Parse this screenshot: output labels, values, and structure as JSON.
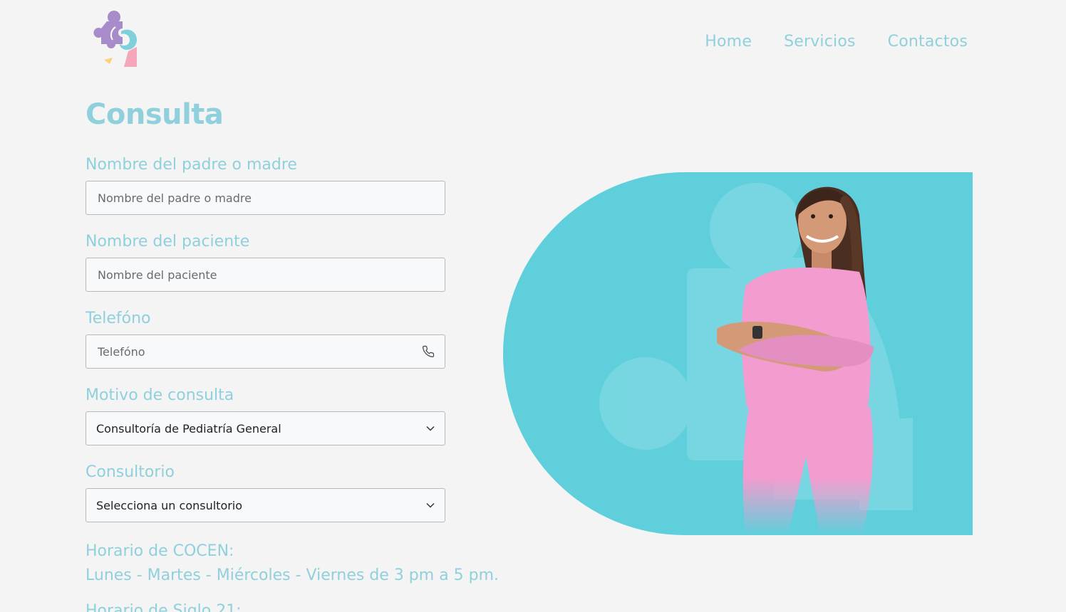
{
  "header": {
    "nav": [
      "Home",
      "Servicios",
      "Contactos"
    ]
  },
  "form": {
    "title": "Consulta",
    "parent": {
      "label": "Nombre del padre o madre",
      "placeholder": "Nombre del padre o madre"
    },
    "patient": {
      "label": "Nombre del paciente",
      "placeholder": "Nombre del paciente"
    },
    "phone": {
      "label": "Telefóno",
      "placeholder": "Telefóno",
      "icon": "phone-icon"
    },
    "reason": {
      "label": "Motivo de consulta",
      "value": "Consultoría de Pediatría General",
      "icon": "chevron-down-icon"
    },
    "office": {
      "label": "Consultorio",
      "value": "Selecciona un consultorio",
      "icon": "chevron-down-icon"
    }
  },
  "schedule": {
    "heading": "Horario de COCEN:",
    "days": "Lunes - Martes - Miércoles - Viernes de 3 pm a 5 pm.",
    "next_heading_partial": "Horario de Siglo 21:"
  },
  "colors": {
    "accent": "#8fd0dc",
    "hero_bg": "#5fcfdc",
    "scrubs": "#f29ccf",
    "logo_purple": "#a78bcb",
    "logo_pink": "#f5a6b8",
    "logo_yellow": "#f8d27a"
  }
}
